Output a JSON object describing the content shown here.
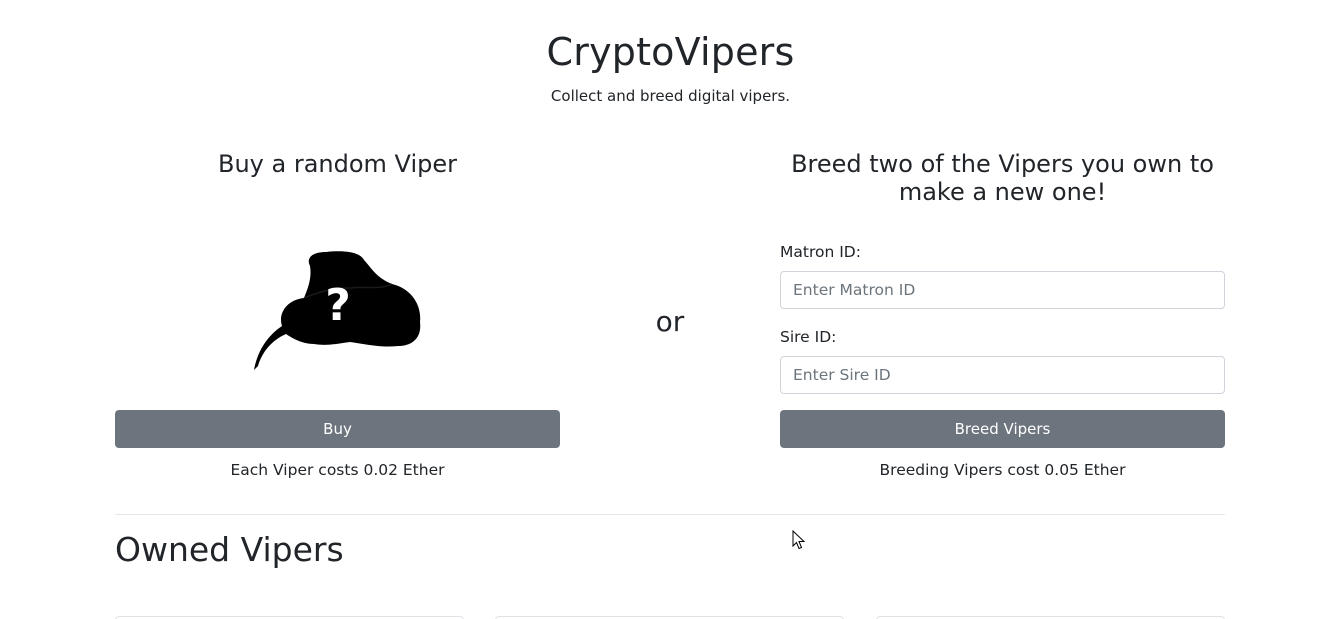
{
  "header": {
    "title": "CryptoVipers",
    "subtitle": "Collect and breed digital vipers."
  },
  "buy_section": {
    "heading": "Buy a random Viper",
    "image_icon": "mystery-viper-icon",
    "button_label": "Buy",
    "cost_note": "Each Viper costs 0.02 Ether"
  },
  "separator": {
    "label": "or"
  },
  "breed_section": {
    "heading": "Breed two of the Vipers you own to make a new one!",
    "matron": {
      "label": "Matron ID:",
      "value": "",
      "placeholder": "Enter Matron ID"
    },
    "sire": {
      "label": "Sire ID:",
      "value": "",
      "placeholder": "Enter Sire ID"
    },
    "button_label": "Breed Vipers",
    "cost_note": "Breeding Vipers cost 0.05 Ether"
  },
  "owned_section": {
    "heading": "Owned Vipers",
    "visible_cards": 3
  },
  "colors": {
    "button_bg": "#6c757d",
    "button_text": "#ffffff",
    "text": "#212529",
    "input_border": "#ced4da",
    "divider": "#e5e7ea"
  }
}
